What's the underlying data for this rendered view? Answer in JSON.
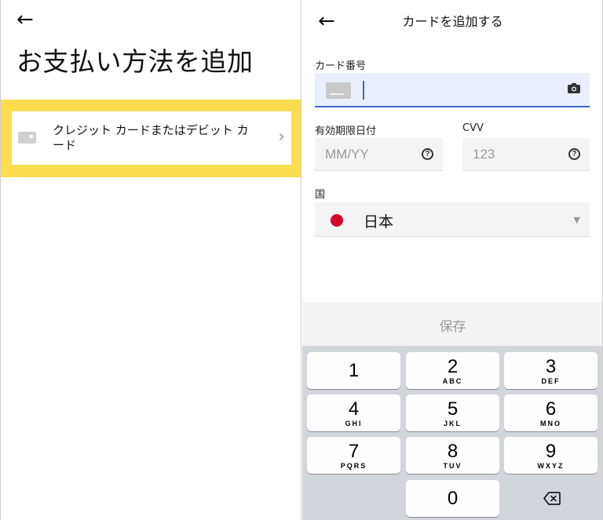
{
  "left": {
    "back_arrow": "←",
    "title": "お支払い方法を追加",
    "option": {
      "label": "クレジット カードまたはデビット カード",
      "chevron": "›"
    }
  },
  "right": {
    "back_arrow": "←",
    "title": "カードを追加する",
    "card_number": {
      "label": "カード番号",
      "value": ""
    },
    "expiry": {
      "label": "有効期限日付",
      "placeholder": "MM/YY",
      "help": "?"
    },
    "cvv": {
      "label": "CVV",
      "placeholder": "123",
      "help": "?"
    },
    "country": {
      "label": "国",
      "value": "日本",
      "arrow": "▼"
    },
    "save_label": "保存",
    "keypad": [
      {
        "digit": "1",
        "letters": ""
      },
      {
        "digit": "2",
        "letters": "ABC"
      },
      {
        "digit": "3",
        "letters": "DEF"
      },
      {
        "digit": "4",
        "letters": "GHI"
      },
      {
        "digit": "5",
        "letters": "JKL"
      },
      {
        "digit": "6",
        "letters": "MNO"
      },
      {
        "digit": "7",
        "letters": "PQRS"
      },
      {
        "digit": "8",
        "letters": "TUV"
      },
      {
        "digit": "9",
        "letters": "WXYZ"
      },
      {
        "digit": "0",
        "letters": ""
      }
    ]
  },
  "colors": {
    "highlight": "#fbdd4f",
    "focus_blue": "#3b66d8",
    "focus_bg": "#e9effd",
    "flag_red": "#d7062b",
    "keyboard_bg": "#d2d5db"
  }
}
